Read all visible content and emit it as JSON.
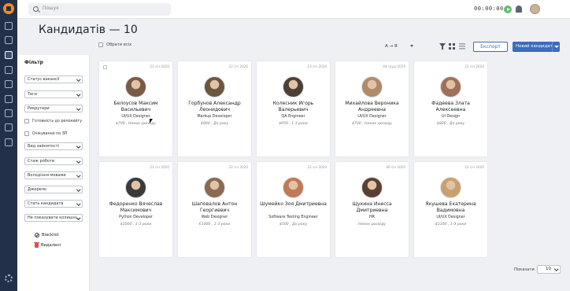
{
  "header": {
    "search_placeholder": "Пошук",
    "timer": "00:00:00"
  },
  "page": {
    "title": "Кандидатів — 10",
    "select_all": "Обрати всіх",
    "sort": "A → Я",
    "export": "Експорт",
    "new_candidate": "Новий кандидат"
  },
  "filters": {
    "title": "Фільтр",
    "vacancy_status": "Статус вакансії",
    "tags": "Теги",
    "recruiters": "Рекрутери",
    "relocation": "Готовність до релокейту",
    "expected_zp": "Очікування по ЗП",
    "employment": "Вид зайнятості",
    "experience": "Стаж роботи",
    "languages": "Володіння мовами",
    "source": "Джерело",
    "gender": "Стать кандидата",
    "hide_colleagues": "Не показувати колишні...",
    "blacklist": "Blacklist",
    "deleted": "Видалені"
  },
  "candidates": [
    {
      "date": "22 січ 2020",
      "name": "Белоусов Максим Васильевич",
      "position": "UI/UX Designer",
      "salary": "$700 , Немає досвіду",
      "photo_color": "#7a5a45"
    },
    {
      "date": "22 січ 2020",
      "name": "Горбунов Александр Леонидович",
      "position": "Markup Developer",
      "salary": "$900 , До року",
      "photo_color": "#6b5640"
    },
    {
      "date": "23 січ 2020",
      "name": "Колесник Игорь Валерьевич",
      "position": "QA Engineer",
      "salary": "$950 , 1-3 роки",
      "photo_color": "#4a4038"
    },
    {
      "date": "04 груд 2019",
      "name": "Михайлова Вероника Андреевна",
      "position": "UI/UX Designer",
      "salary": "$700 , Немає досвіду",
      "photo_color": "#b08a6a"
    },
    {
      "date": "22 січ 2020",
      "name": "Фадеева Злата Алексеевна",
      "position": "UI Design",
      "salary": "$800 , До року",
      "photo_color": "#a0705a"
    },
    {
      "date": "22 січ 2020",
      "name": "Федоренко Вячеслав Максимович",
      "position": "Python Developer",
      "salary": "$1000 , 1-3 роки",
      "photo_color": "#3a3a3a"
    },
    {
      "date": "22 січ 2020",
      "name": "Шаповалов Антон Георгиевич",
      "position": "Web Designer",
      "salary": "€1000 , 1-3 роки",
      "photo_color": "#8a6a55"
    },
    {
      "date": "22 січ 2020",
      "name": "Шумейко Зоя Дмитриевна",
      "position": "Software Testing Engineer",
      "salary": "$500 , До року",
      "photo_color": "#c07a55"
    },
    {
      "date": "06 січ 2020",
      "name": "Щукина Инесса Дмитриевна",
      "position": "HR",
      "salary": "Немає досвіду",
      "photo_color": "#5a4034"
    },
    {
      "date": "22 січ 2020",
      "name": "Якушева Екатерина Вадимовна",
      "position": "UI/UX Designer",
      "salary": "$1100 , 1-3 роки",
      "photo_color": "#c9a070"
    }
  ],
  "pager": {
    "label": "Показати",
    "value": "10"
  }
}
